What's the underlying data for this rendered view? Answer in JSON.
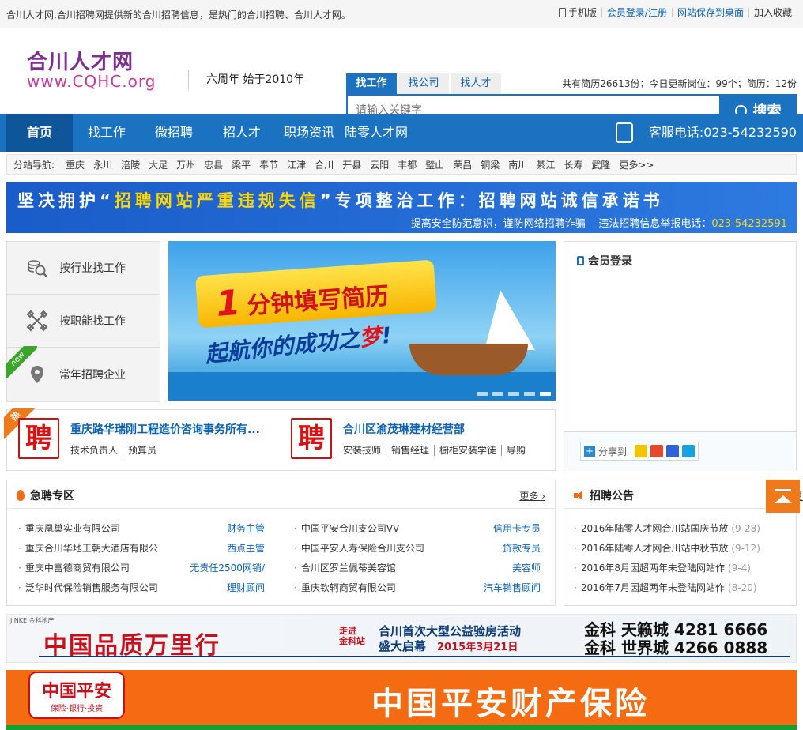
{
  "topbar": {
    "intro": "合川人才网,合川招聘网提供新的合川招聘信息，是热门的合川招聘、合川人才网。",
    "mobile": "手机版",
    "login_register": "会员登录/注册",
    "save_desktop": "网站保存到桌面",
    "favorite": "加入收藏"
  },
  "logo": {
    "cn": "合川人才网",
    "en": "www.CQHC.org"
  },
  "slogan": "六周年  始于2010年",
  "search": {
    "tabs": [
      "找工作",
      "找公司",
      "找人才"
    ],
    "placeholder": "请输入关键字",
    "button": "搜索",
    "stats": "共有简历26613份；今日更新岗位：99个；简历：12份"
  },
  "nav": {
    "items": [
      "首页",
      "找工作",
      "微招聘",
      "招人才",
      "职场资讯",
      "陆零人才网"
    ],
    "hotline": "客服电话:023-54232590"
  },
  "substation": {
    "label": "分站导航:",
    "cities": [
      "重庆",
      "永川",
      "涪陵",
      "大足",
      "万州",
      "忠县",
      "梁平",
      "奉节",
      "江津",
      "合川",
      "开县",
      "云阳",
      "丰都",
      "璧山",
      "荣昌",
      "铜梁",
      "南川",
      "綦江",
      "长寿",
      "武隆"
    ],
    "more": "更多>>"
  },
  "notice": {
    "line1_a": "坚决拥护“",
    "line1_b": "招聘网站严重违规失信",
    "line1_c": "”专项整治工作：招聘网站诚信承诺书",
    "line2_a": "提高安全防范意识，谨防网络招聘诈骗",
    "line2_b": "违法招聘信息举报电话：",
    "line2_tel": "023-54232591"
  },
  "categories": [
    {
      "label": "按行业找工作",
      "icon": "magnifier-coins-icon"
    },
    {
      "label": "按职能找工作",
      "icon": "tools-cross-icon"
    },
    {
      "label": "常年招聘企业",
      "icon": "map-pin-icon"
    }
  ],
  "new_ribbon": "new",
  "banner": {
    "num": "1",
    "headline": "分钟填写简历",
    "sub_a": "起航",
    "sub_b": "你的成功之",
    "sub_c": "梦",
    "sub_d": "!"
  },
  "hot": {
    "tag": "热",
    "pin": "聘",
    "companies": [
      {
        "name": "重庆路华瑞刚工程造价咨询事务所有...",
        "jobs": [
          "技术负责人",
          "预算员"
        ]
      },
      {
        "name": "合川区渝茂琳建材经营部",
        "jobs": [
          "安装技师",
          "销售经理",
          "橱柜安装学徒",
          "导购"
        ]
      }
    ]
  },
  "login": {
    "title": "会员登录",
    "share": "分享到"
  },
  "urgent": {
    "title": "急聘专区",
    "more": "更多",
    "rows": [
      {
        "company": "重庆凰巢实业有限公司",
        "job": "财务主管"
      },
      {
        "company": "中国平安合川支公司VV",
        "job": "信用卡专员"
      },
      {
        "company": "重庆合川华地王朝大酒店有限公",
        "job": "西点主管"
      },
      {
        "company": "中国平安人寿保险合川支公司",
        "job": "贷款专员"
      },
      {
        "company": "重庆中富德商贸有限公司",
        "job": "无责任2500网销/"
      },
      {
        "company": "合川区罗兰佩蒂美容馆",
        "job": "美容师"
      },
      {
        "company": "泛华时代保险销售服务有限公司",
        "job": "理财顾问"
      },
      {
        "company": "重庆钦轲商贸有限公司",
        "job": "汽车销售顾问"
      }
    ]
  },
  "announce": {
    "title": "招聘公告",
    "more": "更多",
    "items": [
      {
        "title": "2016年陆零人才网合川站国庆节放",
        "date": "(9-28)"
      },
      {
        "title": "2016年陆零人才网合川站中秋节放",
        "date": "(9-12)"
      },
      {
        "title": "2016年8月因超两年未登陆网站作",
        "date": "(9-4)"
      },
      {
        "title": "2016年7月因超两年未登陆网站作",
        "date": "(8-20)"
      }
    ]
  },
  "ad1": {
    "brand_small": "JINKE 金科地产",
    "headline": "中国品质万里行",
    "tag_a": "走进",
    "tag_b": "金科站",
    "event": "合川首次大型公益验房活动",
    "event2": "盛大启幕",
    "date": "2015年3月21日",
    "line1": "金科 天籁城  4281 6666",
    "line2": "金科 世界城  4266 0888"
  },
  "ad2": {
    "logo": "中国平安",
    "logo_sub": "保险·银行·投资",
    "headline": "中国平安财产保险"
  },
  "colors": {
    "primary": "#1a72c0",
    "accent": "#f07a1a",
    "link": "#0b62b5"
  }
}
